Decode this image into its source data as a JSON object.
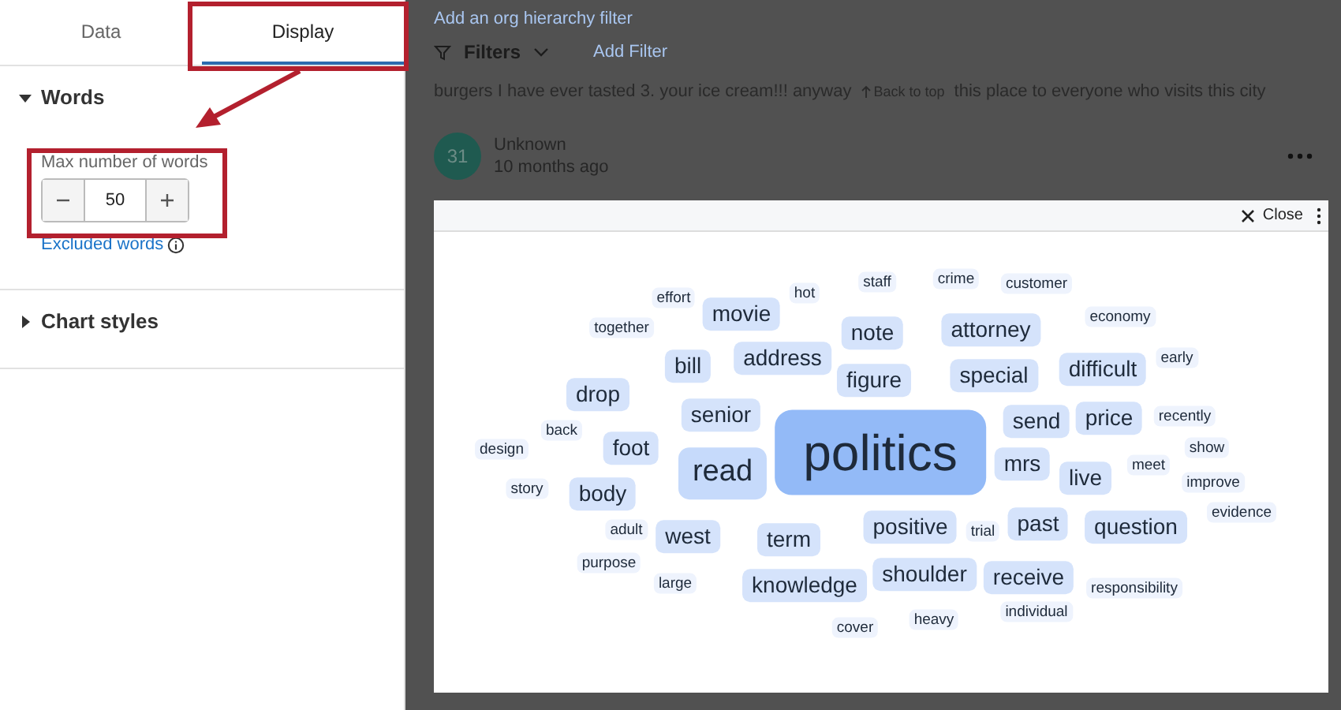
{
  "sidebar": {
    "tabs": [
      {
        "label": "Data",
        "selected": false
      },
      {
        "label": "Display",
        "selected": true
      }
    ],
    "sections": [
      {
        "title": "Words",
        "expanded": true,
        "stepper": {
          "label": "Max number of words",
          "value": "50"
        },
        "link": "Excluded words"
      },
      {
        "title": "Chart styles",
        "expanded": false
      }
    ]
  },
  "background": {
    "org_filter_link": "Add an org hierarchy filter",
    "filters": {
      "label": "Filters",
      "add": "Add Filter"
    },
    "comment": {
      "before": "burgers I have ever tasted 3. your ice cream!!! anyway",
      "back_to_top": "Back to top",
      "after": "this place to everyone who visits this city"
    },
    "response": {
      "avatar": "31",
      "author": "Unknown",
      "time": "10 months ago"
    }
  },
  "modal": {
    "close": "Close",
    "words": [
      {
        "text": "effort",
        "kind": "small"
      },
      {
        "text": "hot",
        "kind": "small"
      },
      {
        "text": "staff",
        "kind": "small"
      },
      {
        "text": "crime",
        "kind": "small"
      },
      {
        "text": "customer",
        "kind": "small"
      },
      {
        "text": "together",
        "kind": "small"
      },
      {
        "text": "movie",
        "kind": "medium"
      },
      {
        "text": "note",
        "kind": "medium"
      },
      {
        "text": "attorney",
        "kind": "medium"
      },
      {
        "text": "economy",
        "kind": "small"
      },
      {
        "text": "bill",
        "kind": "medium"
      },
      {
        "text": "address",
        "kind": "medium"
      },
      {
        "text": "figure",
        "kind": "medium"
      },
      {
        "text": "special",
        "kind": "medium"
      },
      {
        "text": "difficult",
        "kind": "medium"
      },
      {
        "text": "early",
        "kind": "small"
      },
      {
        "text": "drop",
        "kind": "medium"
      },
      {
        "text": "senior",
        "kind": "medium"
      },
      {
        "text": "politics",
        "kind": "top"
      },
      {
        "text": "send",
        "kind": "medium"
      },
      {
        "text": "price",
        "kind": "medium"
      },
      {
        "text": "recently",
        "kind": "small"
      },
      {
        "text": "back",
        "kind": "small"
      },
      {
        "text": "design",
        "kind": "small"
      },
      {
        "text": "foot",
        "kind": "medium"
      },
      {
        "text": "read",
        "kind": "large"
      },
      {
        "text": "mrs",
        "kind": "medium"
      },
      {
        "text": "live",
        "kind": "medium"
      },
      {
        "text": "meet",
        "kind": "small"
      },
      {
        "text": "show",
        "kind": "small"
      },
      {
        "text": "improve",
        "kind": "small"
      },
      {
        "text": "story",
        "kind": "small"
      },
      {
        "text": "body",
        "kind": "medium"
      },
      {
        "text": "positive",
        "kind": "medium"
      },
      {
        "text": "trial",
        "kind": "small"
      },
      {
        "text": "past",
        "kind": "medium"
      },
      {
        "text": "question",
        "kind": "medium"
      },
      {
        "text": "evidence",
        "kind": "small"
      },
      {
        "text": "adult",
        "kind": "small"
      },
      {
        "text": "west",
        "kind": "medium"
      },
      {
        "text": "term",
        "kind": "medium"
      },
      {
        "text": "purpose",
        "kind": "small"
      },
      {
        "text": "large",
        "kind": "small"
      },
      {
        "text": "knowledge",
        "kind": "medium"
      },
      {
        "text": "shoulder",
        "kind": "medium"
      },
      {
        "text": "receive",
        "kind": "medium"
      },
      {
        "text": "responsibility",
        "kind": "small"
      },
      {
        "text": "individual",
        "kind": "small"
      },
      {
        "text": "cover",
        "kind": "small"
      },
      {
        "text": "heavy",
        "kind": "small"
      }
    ]
  }
}
